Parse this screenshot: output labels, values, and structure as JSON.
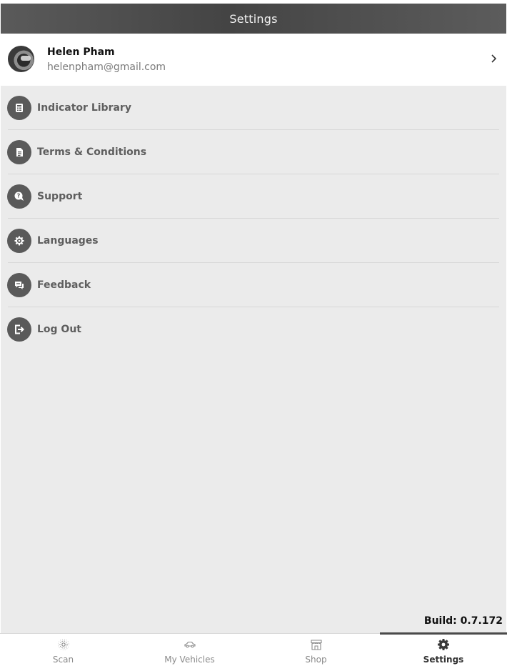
{
  "header": {
    "title": "Settings"
  },
  "profile": {
    "name": "Helen Pham",
    "email": "helenpham@gmail.com"
  },
  "menu": {
    "items": [
      {
        "label": "Indicator Library",
        "icon": "indicator-library-icon"
      },
      {
        "label": "Terms & Conditions",
        "icon": "document-icon"
      },
      {
        "label": "Support",
        "icon": "support-icon"
      },
      {
        "label": "Languages",
        "icon": "languages-gear-icon"
      },
      {
        "label": "Feedback",
        "icon": "feedback-icon"
      },
      {
        "label": "Log Out",
        "icon": "logout-icon"
      }
    ]
  },
  "build": {
    "label": "Build: 0.7.172"
  },
  "tabbar": {
    "tabs": [
      {
        "label": "Scan",
        "icon": "scan-icon",
        "active": false
      },
      {
        "label": "My Vehicles",
        "icon": "car-icon",
        "active": false
      },
      {
        "label": "Shop",
        "icon": "shop-icon",
        "active": false
      },
      {
        "label": "Settings",
        "icon": "settings-gear-icon",
        "active": true
      }
    ]
  },
  "colors": {
    "header_bg": "#4f4f4f",
    "content_bg": "#ebebeb",
    "icon_circle": "#5a5a5a",
    "menu_text": "#5e5e5e",
    "tab_inactive": "#8a8a8a"
  }
}
